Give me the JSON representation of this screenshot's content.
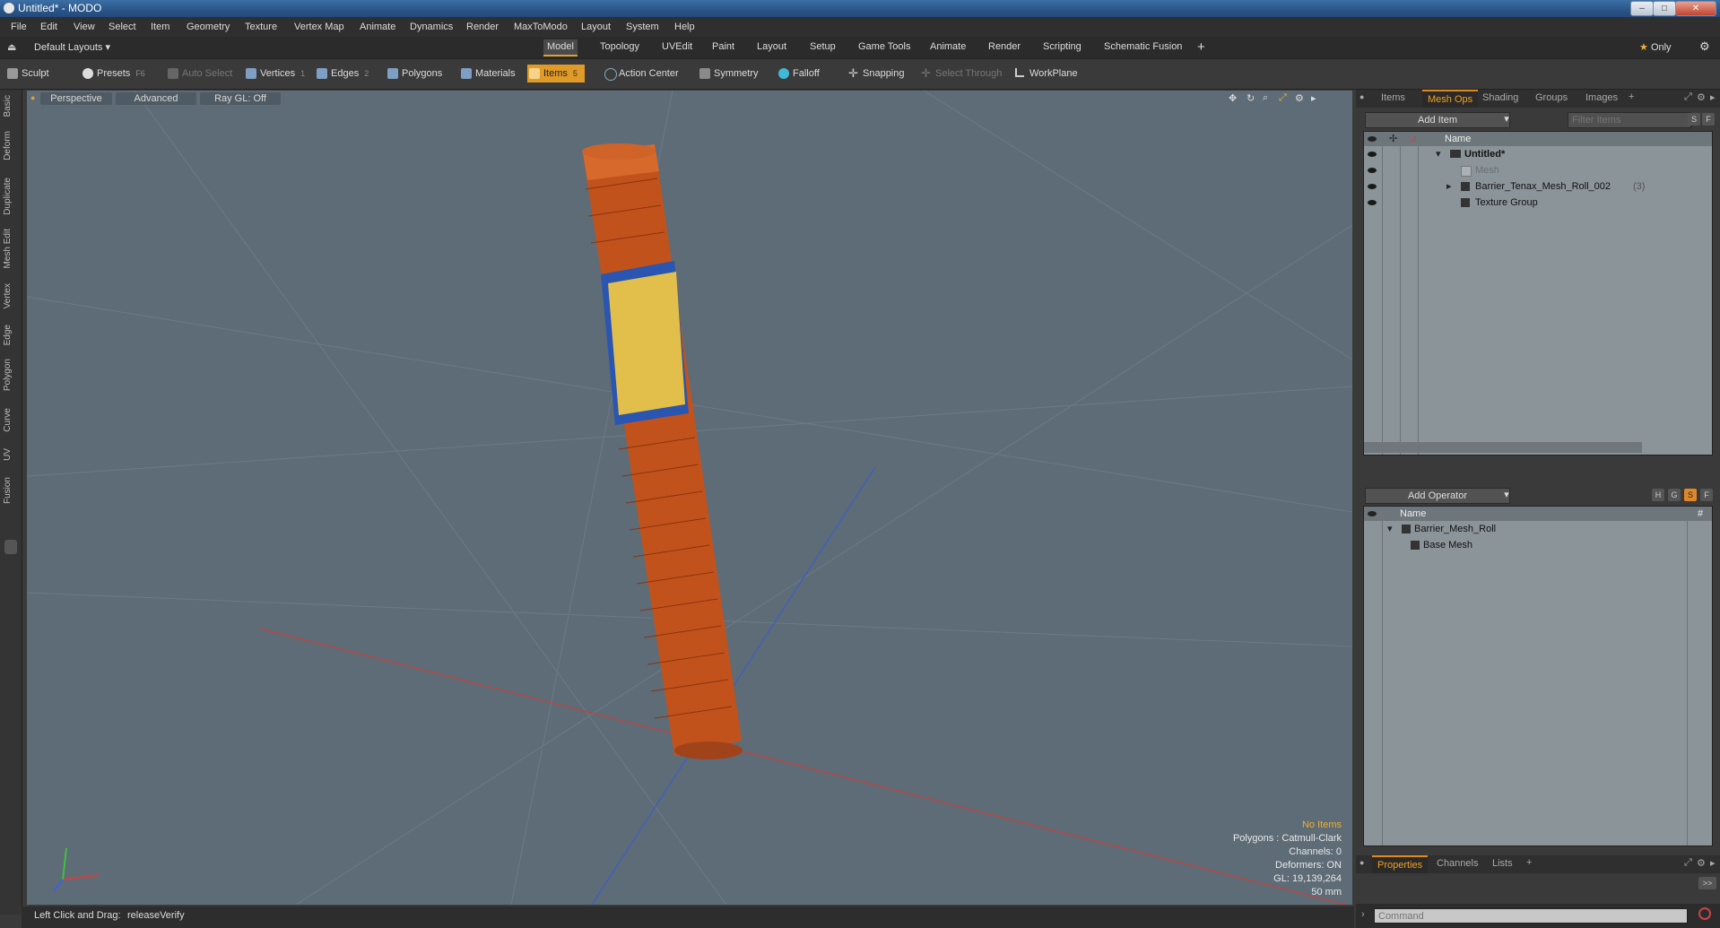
{
  "window": {
    "title": "Untitled* - MODO"
  },
  "menu": [
    "File",
    "Edit",
    "View",
    "Select",
    "Item",
    "Geometry",
    "Texture",
    "Vertex Map",
    "Animate",
    "Dynamics",
    "Render",
    "MaxToModo",
    "Layout",
    "System",
    "Help"
  ],
  "layout_selector": "Default Layouts",
  "tabs": [
    "Model",
    "Topology",
    "UVEdit",
    "Paint",
    "Layout",
    "Setup",
    "Game Tools",
    "Animate",
    "Render",
    "Scripting",
    "Schematic Fusion"
  ],
  "active_tab": "Model",
  "only_label": "Only",
  "toolbar": {
    "sculpt": "Sculpt",
    "presets": "Presets",
    "presets_key": "F6",
    "auto_select": "Auto Select",
    "vertices": "Vertices",
    "vertices_key": "1",
    "edges": "Edges",
    "edges_key": "2",
    "polygons": "Polygons",
    "materials": "Materials",
    "items": "Items",
    "items_key": "5",
    "action_center": "Action Center",
    "symmetry": "Symmetry",
    "falloff": "Falloff",
    "snapping": "Snapping",
    "select_through": "Select Through",
    "workplane": "WorkPlane"
  },
  "left_tabs": [
    "Basic",
    "Deform",
    "Duplicate",
    "Mesh Edit",
    "Vertex",
    "Edge",
    "Polygon",
    "Curve",
    "UV",
    "Fusion"
  ],
  "viewport": {
    "view": "Perspective",
    "mode": "Advanced",
    "raygl": "Ray GL: Off",
    "hud": {
      "selection": "No Items",
      "polygons": "Polygons : Catmull-Clark",
      "channels": "Channels: 0",
      "deformers": "Deformers: ON",
      "gl": "GL: 19,139,264",
      "scale": "50 mm"
    }
  },
  "status": {
    "hint": "Left Click and Drag:",
    "action": "releaseVerify"
  },
  "item_panel": {
    "tabs": [
      "Items",
      "Mesh Ops",
      "Shading",
      "Groups",
      "Images"
    ],
    "active_tab": "Mesh Ops",
    "add_item": "Add Item",
    "filter_placeholder": "Filter Items",
    "s_btn": "S",
    "f_btn": "F",
    "col_name": "Name",
    "rows": [
      {
        "label": "Untitled*",
        "count": ""
      },
      {
        "label": "Mesh",
        "count": ""
      },
      {
        "label": "Barrier_Tenax_Mesh_Roll_002",
        "count": "(3)"
      },
      {
        "label": "Texture Group",
        "count": ""
      }
    ]
  },
  "meshops_panel": {
    "add_operator": "Add Operator",
    "h_btn": "H",
    "g_btn": "G",
    "s_btn": "S",
    "f_btn": "F",
    "col_name": "Name",
    "col_hash": "#",
    "rows": [
      {
        "label": "Barrier_Mesh_Roll"
      },
      {
        "label": "Base Mesh"
      }
    ]
  },
  "props_panel": {
    "tabs": [
      "Properties",
      "Channels",
      "Lists"
    ],
    "active_tab": "Properties",
    "expand": ">>",
    "command_placeholder": "Command"
  }
}
